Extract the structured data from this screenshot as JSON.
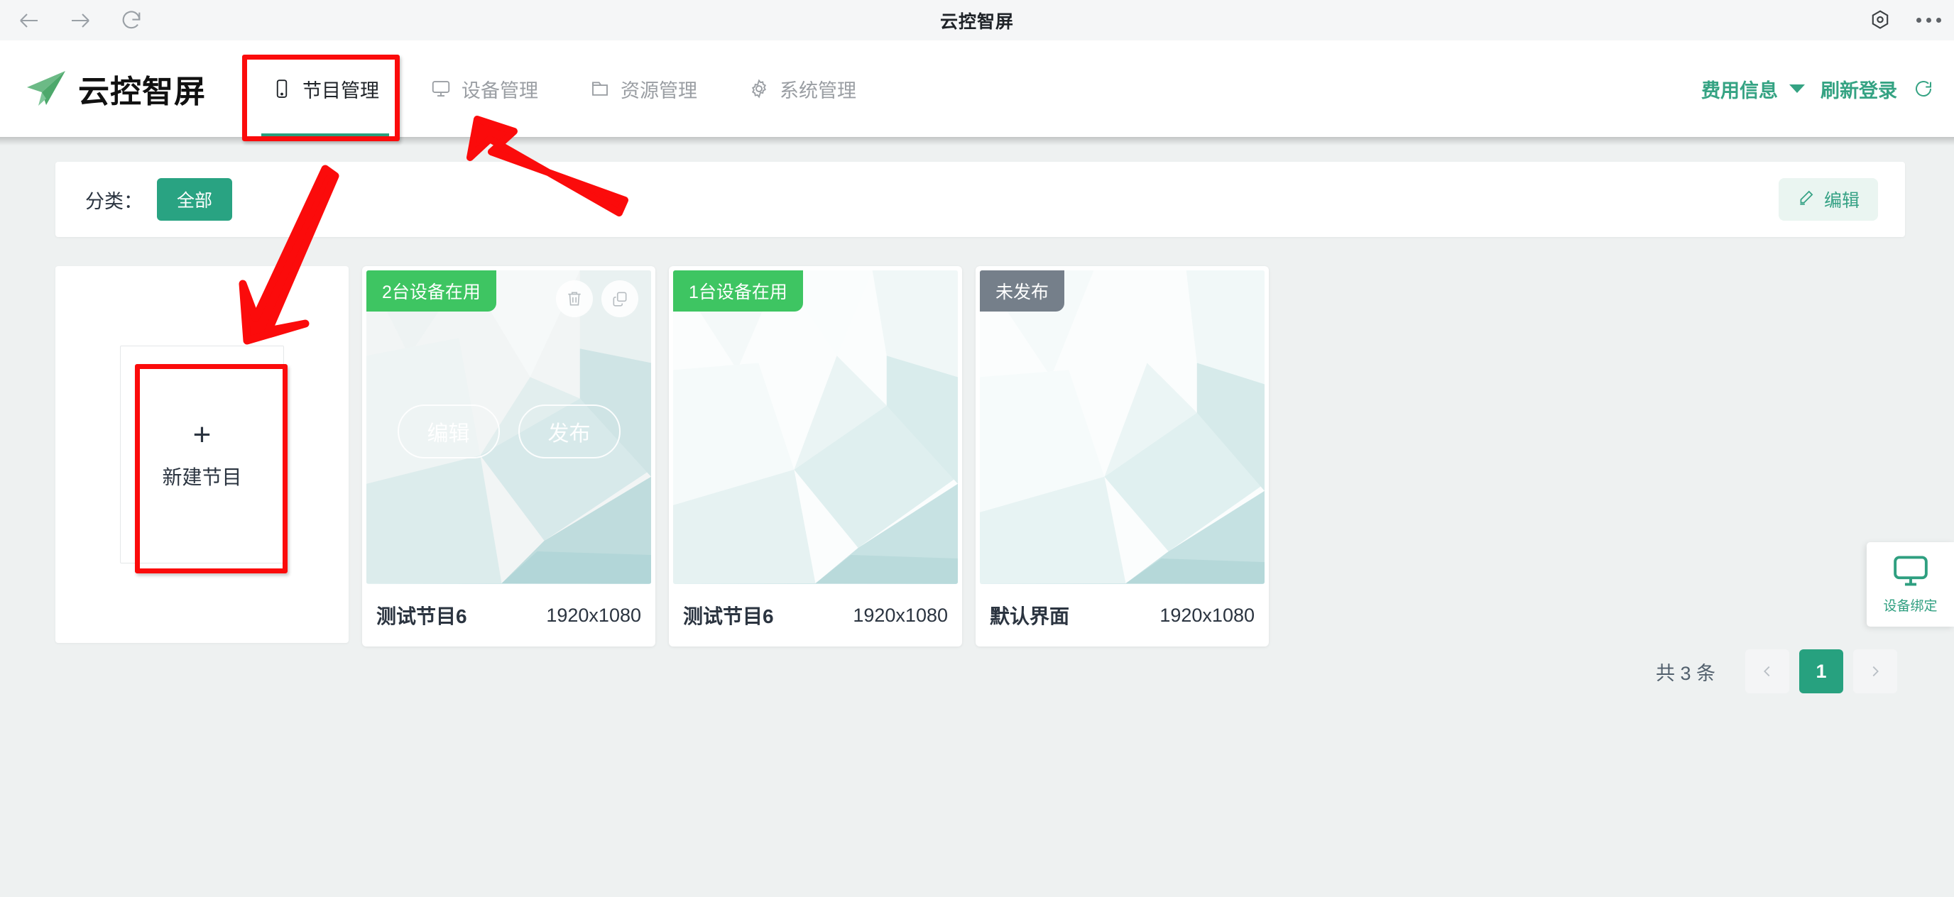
{
  "browser": {
    "title": "云控智屏",
    "back_icon": "arrow-left-icon",
    "forward_icon": "arrow-right-icon",
    "reload_icon": "reload-icon",
    "settings_icon": "hexagon-gear-icon",
    "more_icon": "more-options-icon"
  },
  "app_header": {
    "brand": "云控智屏",
    "logo_icon": "paper-plane-icon",
    "nav": [
      {
        "label": "节目管理",
        "icon": "mobile-screen-icon",
        "active": true
      },
      {
        "label": "设备管理",
        "icon": "monitor-icon",
        "active": false
      },
      {
        "label": "资源管理",
        "icon": "folder-icon",
        "active": false
      },
      {
        "label": "系统管理",
        "icon": "gear-icon",
        "active": false
      }
    ],
    "account": {
      "fee_info": "费用信息",
      "refresh_login": "刷新登录",
      "dropdown_icon": "caret-down-icon",
      "refresh_icon": "refresh-icon"
    }
  },
  "filter_bar": {
    "label": "分类：",
    "chips": [
      "全部"
    ],
    "edit_button": "编辑",
    "edit_icon": "pencil-icon"
  },
  "new_card": {
    "plus": "+",
    "label": "新建节目"
  },
  "programs": [
    {
      "name": "测试节目6",
      "resolution": "1920x1080",
      "badge": "2台设备在用",
      "badge_type": "green",
      "hovered": true,
      "actions": [
        {
          "label": "编辑",
          "name": "edit"
        },
        {
          "label": "发布",
          "name": "publish"
        }
      ],
      "icon_actions": [
        {
          "icon": "trash-icon",
          "name": "delete"
        },
        {
          "icon": "copy-icon",
          "name": "duplicate"
        }
      ]
    },
    {
      "name": "测试节目6",
      "resolution": "1920x1080",
      "badge": "1台设备在用",
      "badge_type": "green",
      "hovered": false
    },
    {
      "name": "默认界面",
      "resolution": "1920x1080",
      "badge": "未发布",
      "badge_type": "grey",
      "hovered": false
    }
  ],
  "pagination": {
    "total_text": "共 3 条",
    "prev_icon": "chevron-left-icon",
    "next_icon": "chevron-right-icon",
    "pages": [
      "1"
    ],
    "current": "1"
  },
  "float_widget": {
    "label": "设备绑定",
    "icon": "monitor-icon"
  },
  "colors": {
    "accent_green": "#29a382",
    "badge_green": "#3ec562",
    "badge_grey": "#757f8a",
    "annotation_red": "#fb0b0b",
    "page_bg": "#eef1f1"
  }
}
